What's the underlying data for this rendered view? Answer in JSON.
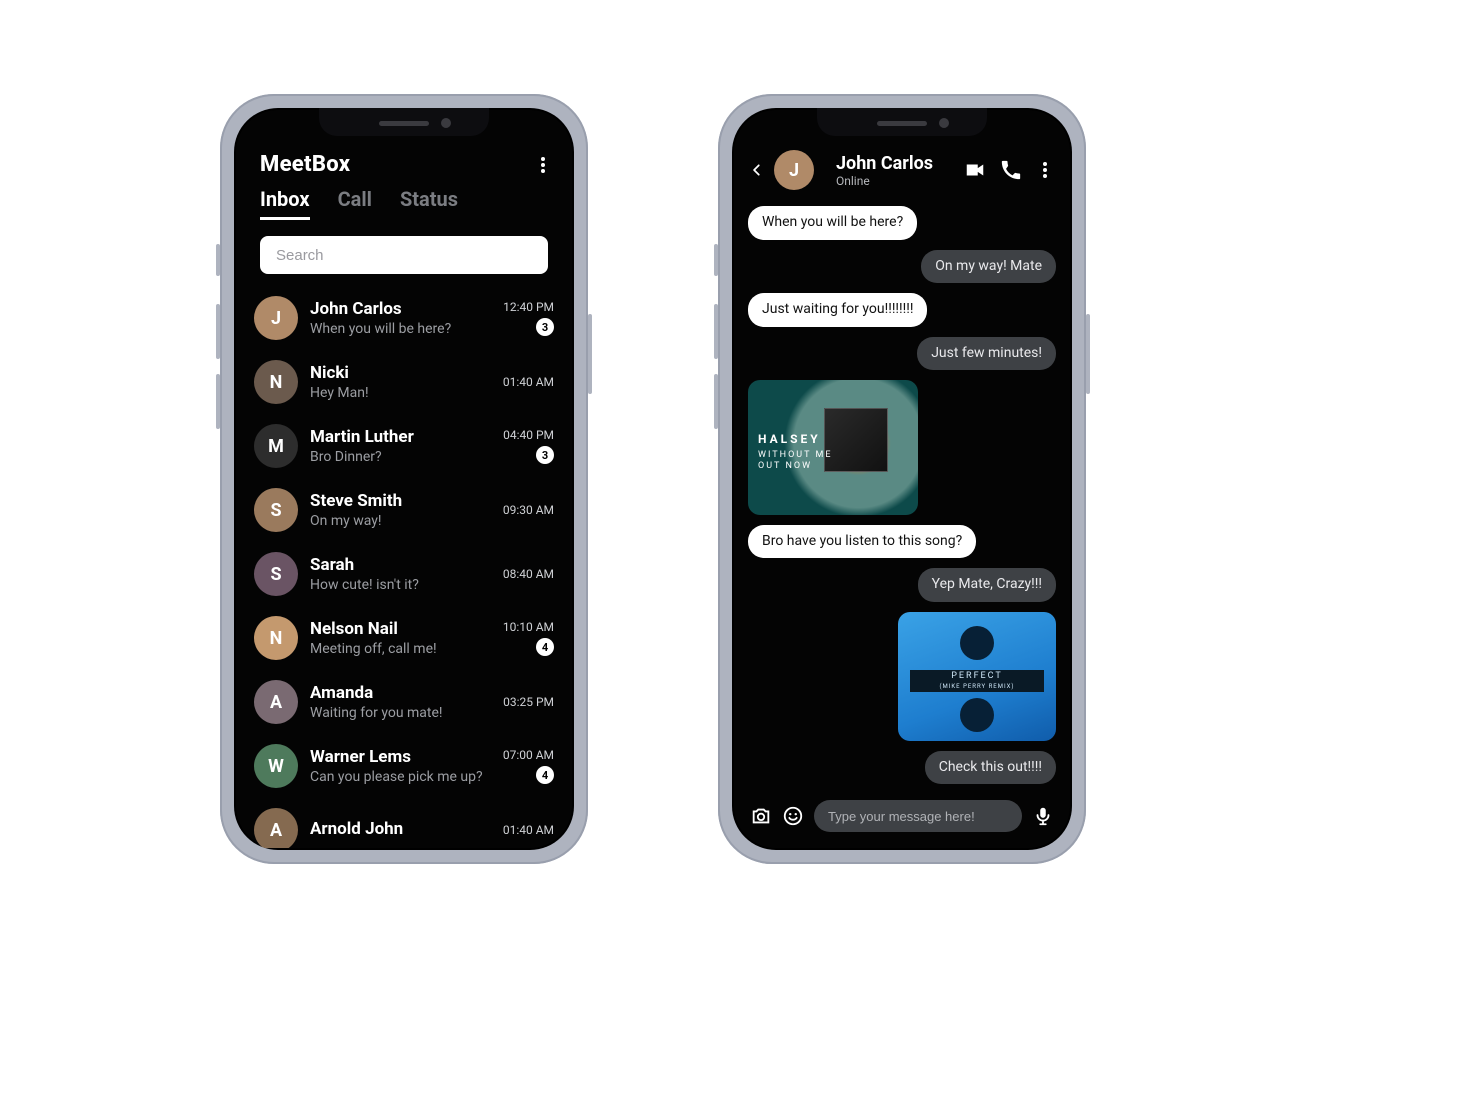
{
  "app": {
    "title": "MeetBox"
  },
  "tabs": [
    {
      "label": "Inbox",
      "active": true
    },
    {
      "label": "Call",
      "active": false
    },
    {
      "label": "Status",
      "active": false
    }
  ],
  "search": {
    "placeholder": "Search"
  },
  "conversations": [
    {
      "name": "John Carlos",
      "preview": "When you will be here?",
      "time": "12:40 PM",
      "badge": "3",
      "avatar_bg": "#b08a68"
    },
    {
      "name": "Nicki",
      "preview": "Hey Man!",
      "time": "01:40 AM",
      "badge": null,
      "avatar_bg": "#6b5a4d"
    },
    {
      "name": "Martin Luther",
      "preview": "Bro Dinner?",
      "time": "04:40 PM",
      "badge": "3",
      "avatar_bg": "#2d2d2d"
    },
    {
      "name": "Steve Smith",
      "preview": "On my way!",
      "time": "09:30 AM",
      "badge": null,
      "avatar_bg": "#9a7a5d"
    },
    {
      "name": "Sarah",
      "preview": "How cute! isn't it?",
      "time": "08:40 AM",
      "badge": null,
      "avatar_bg": "#6a5464"
    },
    {
      "name": "Nelson Nail",
      "preview": "Meeting off, call me!",
      "time": "10:10 AM",
      "badge": "4",
      "avatar_bg": "#c4996e"
    },
    {
      "name": "Amanda",
      "preview": "Waiting for you mate!",
      "time": "03:25 PM",
      "badge": null,
      "avatar_bg": "#7a6a72"
    },
    {
      "name": "Warner Lems",
      "preview": "Can you please pick me up?",
      "time": "07:00 AM",
      "badge": "4",
      "avatar_bg": "#4e7a5c"
    },
    {
      "name": "Arnold John",
      "preview": "",
      "time": "01:40 AM",
      "badge": null,
      "avatar_bg": "#856a50"
    }
  ],
  "chat": {
    "contact": {
      "name": "John Carlos",
      "status": "Online",
      "avatar_bg": "#b08a68"
    },
    "messages": [
      {
        "side": "in",
        "type": "text",
        "text": "When you will be here?"
      },
      {
        "side": "out",
        "type": "text",
        "text": "On my way! Mate"
      },
      {
        "side": "in",
        "type": "text",
        "text": "Just waiting for you!!!!!!!!"
      },
      {
        "side": "out",
        "type": "text",
        "text": "Just few minutes!"
      },
      {
        "side": "in",
        "type": "media",
        "media": "halsey",
        "title": "HALSEY",
        "subtitle": "WITHOUT ME",
        "caption": "OUT NOW"
      },
      {
        "side": "in",
        "type": "text",
        "text": "Bro have you listen to this song?"
      },
      {
        "side": "out",
        "type": "text",
        "text": "Yep Mate, Crazy!!!"
      },
      {
        "side": "out",
        "type": "media",
        "media": "divide",
        "title": "PERFECT",
        "subtitle": "(MIKE PERRY REMIX)"
      },
      {
        "side": "out",
        "type": "text",
        "text": "Check this out!!!!"
      }
    ],
    "input": {
      "placeholder": "Type your message here!"
    }
  }
}
